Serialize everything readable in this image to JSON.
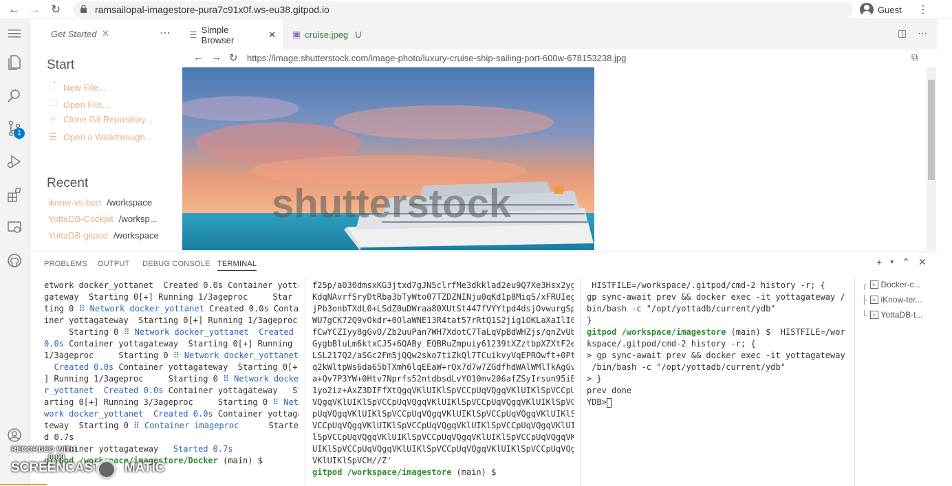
{
  "browser": {
    "url": "ramsailopal-imagestore-pura7c91x0f.ws-eu38.gitpod.io",
    "profile": "Guest"
  },
  "sidebar": {
    "tab_label": "Get Started",
    "start_title": "Start",
    "start_items": [
      "New File...",
      "Open File...",
      "Clone Git Repository...",
      "Open a Walkthrough..."
    ],
    "recent_title": "Recent",
    "recent": [
      {
        "name": "iknow-vs-bert",
        "path": "/workspace"
      },
      {
        "name": "YottaDB-Cockpit",
        "path": "/worksp..."
      },
      {
        "name": "YottaDB-gitpod",
        "path": "/workspace"
      }
    ],
    "scm_badge": "1"
  },
  "editor": {
    "tabs": [
      {
        "label": "Simple Browser"
      },
      {
        "label": "cruise.jpeg",
        "status": "U"
      }
    ],
    "browser_url": "https://image.shutterstock.com/image-photo/luxury-cruise-ship-sailing-port-600w-678153238.jpg",
    "watermark": "shutterstock"
  },
  "panel": {
    "tabs": [
      "PROBLEMS",
      "OUTPUT",
      "DEBUG CONSOLE",
      "TERMINAL"
    ],
    "active_tab": "TERMINAL",
    "terminal_1": [
      [
        [
          "",
          "etwork docker_yottanet  Created 0.0s Container yotta"
        ]
      ],
      [
        [
          "",
          "gateway  Starting 0[+] Running 1/3ageproc     Star"
        ]
      ],
      [
        [
          "",
          "ting 0 "
        ],
        [
          "blue",
          "⠿ Network docker_yottanet"
        ],
        [
          "",
          " Created 0.0s Conta"
        ]
      ],
      [
        [
          "",
          "iner yottagateway  Starting 0[+] Running 1/3ageproc"
        ]
      ],
      [
        [
          "",
          "     Starting 0 "
        ],
        [
          "blue",
          "⠿ Network docker_yottanet  Created"
        ]
      ],
      [
        [
          "blue",
          "0.0s"
        ],
        [
          "",
          " Container yottagateway  Starting 0[+] Running"
        ]
      ],
      [
        [
          "",
          "1/3ageproc     Starting 0 "
        ],
        [
          "blue",
          "⠿ Network docker_yottanet"
        ]
      ],
      [
        [
          "blue",
          "  Created 0.0s"
        ],
        [
          "",
          " Container yottagateway  Starting 0[+"
        ]
      ],
      [
        [
          "",
          "] Running 1/3ageproc     Starting 0 "
        ],
        [
          "blue",
          "⠿ Network docke"
        ]
      ],
      [
        [
          "blue",
          "r_yottanet  Created 0.0s"
        ],
        [
          "",
          " Container yottagateway   St"
        ]
      ],
      [
        [
          "",
          "arting 0[+] Running 3/3ageproc     Starting 0 "
        ],
        [
          "blue",
          "⠿ Net"
        ]
      ],
      [
        [
          "blue",
          "work docker_yottanet  Created 0.0s"
        ],
        [
          "",
          " Container yottaga"
        ]
      ],
      [
        [
          "",
          "teway  Starting 0 "
        ],
        [
          "blue",
          "⠿ Container imageproc"
        ],
        [
          "",
          "      Starte"
        ]
      ],
      [
        [
          "",
          "d 0.7s"
        ]
      ],
      [
        [
          "",
          "    tainer yottagateway   "
        ],
        [
          "blue",
          "Started 0.7s"
        ]
      ],
      [
        [
          "green",
          "gitpod /workspace/imagestore/Docker"
        ],
        [
          "",
          " (main) $"
        ]
      ]
    ],
    "terminal_2": [
      [
        [
          "",
          "f25p/a030dmsxKG3jtxd7gJN5clrfMe3dkklad2eu9Q7Xe3Hsx2yg7"
        ]
      ],
      [
        [
          "",
          "KdqNAvrfSryDtRba3bTyWto07TZDZNINju0qKd1p8MiqS/xFRUIeg9"
        ]
      ],
      [
        [
          "",
          "jPb3onbTXdL0+LSdZ0uDWraa80XUtSt447fVYYtpd4dsjOvwurgSpG"
        ]
      ],
      [
        [
          "",
          "WU7gCK72Q9vOkdr+0OlaWNE13R4tat57rRtQ1S2jig1OKLaXaIlI0i"
        ]
      ],
      [
        [
          "",
          "fCwYCZIyy8gGvO/Zb2uuPan7WH7XdotC7TaLqVpBdWHZjs/qnZvUbS"
        ]
      ],
      [
        [
          "",
          "GygbBluLm6ktxCJ5+6QABy EQBRuZmpuiy61239tXZztbpXZXtF2e1u"
        ]
      ],
      [
        [
          "",
          "LSL217Q2/aSGc2Fm5jQQw2sko7tiZkQl7TCuikvyVqEPROwft+0Pt/"
        ]
      ],
      [
        [
          "",
          "q2kWltpWs6da65bTXmh6lqEEaW+rQx7d7w7ZGdfhdWAlWMlTkAgGvT"
        ]
      ],
      [
        [
          "",
          "a+Qv7P3YW+0Htv7Nprfs52ntdbsdLvYO10mv206afZSyIrsun95iBA"
        ]
      ],
      [
        [
          "",
          "1yo2iz+AxZ3DIFfXtQgqVKlUIKlSpVCCpUqVQgqVKlUIKlSpVCCpUq"
        ]
      ],
      [
        [
          "",
          "VQgqVKlUIKlSpVCCpUqVQgqVKlUIKlSpVCCpUqVQgqVKlUIKlSpVCC"
        ]
      ],
      [
        [
          "",
          "pUqVQgqVKlUIKlSpVCCpUqVQgqVKlUIKlSpVCCpUqVQgqVKlUIKlSp"
        ]
      ],
      [
        [
          "",
          "VCCpUqVQgqVKlUIKlSpVCCpUqVQgqVKlUIKlSpVCCpUqVQgqVKlUIK"
        ]
      ],
      [
        [
          "",
          "lSpVCCpUqVQgqVKlUIKlSpVCCpUqVQgqVKlUIKlSpVCCpUqVQgqVKl"
        ]
      ],
      [
        [
          "",
          "UIKlSpVCCpUqVQgqVKlUIKlSpVCCpUqVQgqVKlUIKlSpVCCpUqVQgq"
        ]
      ],
      [
        [
          "",
          "VKlUIKlSpVCH//Z'"
        ]
      ],
      [
        [
          "green",
          "gitpod /workspace/imagestore"
        ],
        [
          "",
          " (main) $"
        ]
      ]
    ],
    "terminal_3": [
      [
        [
          "",
          " HISTFILE=/workspace/.gitpod/cmd-2 history -r; {"
        ]
      ],
      [
        [
          "",
          "gp sync-await prev && docker exec -it yottagateway /"
        ]
      ],
      [
        [
          "",
          "bin/bash -c \"/opt/yottadb/current/ydb\""
        ]
      ],
      [
        [
          "",
          "}"
        ]
      ],
      [
        [
          "green",
          "gitpod /workspace/imagestore"
        ],
        [
          "",
          " (main) $  HISTFILE=/wor"
        ]
      ],
      [
        [
          "",
          "kspace/.gitpod/cmd-2 history -r; {"
        ]
      ],
      [
        [
          "",
          "> gp sync-await prev && docker exec -it yottagateway"
        ]
      ],
      [
        [
          "",
          " /bin/bash -c \"/opt/yottadb/current/ydb\""
        ]
      ],
      [
        [
          "",
          "> }"
        ]
      ],
      [
        [
          "",
          "prev done"
        ]
      ],
      [
        [
          "",
          ""
        ]
      ],
      [
        [
          "",
          "YDB>"
        ]
      ]
    ],
    "terminal_list": [
      "Docker-c...",
      "iKnow-ter...",
      "YottaDB-t..."
    ]
  },
  "recording": {
    "label": "RECORDED WITH",
    "time": "0:00",
    "brand": "SCREENCAST",
    "brand_suffix": "MATIC"
  }
}
